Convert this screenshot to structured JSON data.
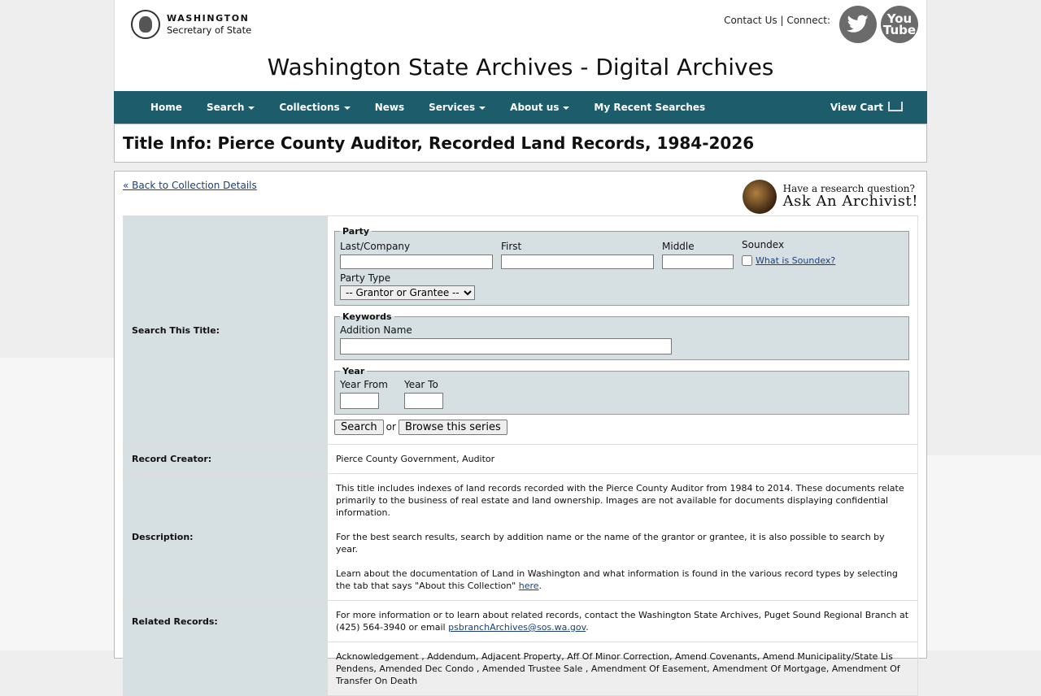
{
  "header": {
    "logo_line1": "WASHINGTON",
    "logo_line2": "Secretary of State",
    "contact": "Contact Us",
    "separator": "|",
    "connect": "Connect:",
    "youtube_line1": "You",
    "youtube_line2": "Tube",
    "site_title": "Washington State Archives - Digital Archives"
  },
  "nav": {
    "items": [
      {
        "label": "Home"
      },
      {
        "label": "Search"
      },
      {
        "label": "Collections"
      },
      {
        "label": "News"
      },
      {
        "label": "Services"
      },
      {
        "label": "About us"
      },
      {
        "label": "My Recent Searches"
      }
    ],
    "cart": "View Cart"
  },
  "page_title": "Title Info: Pierce County Auditor, Recorded Land Records, 1984-2026",
  "back_link": "« Back to Collection Details",
  "ask": {
    "line1": "Have a research question?",
    "line2": "Ask An Archivist!"
  },
  "search": {
    "label": "Search This Title:",
    "party_legend": "Party",
    "last_label": "Last/Company",
    "first_label": "First",
    "middle_label": "Middle",
    "soundex_label": "Soundex",
    "soundex_link": "What is Soundex?",
    "party_type_label": "Party Type",
    "party_type_selected": "-- Grantor or Grantee --",
    "keywords_legend": "Keywords",
    "addition_label": "Addition Name",
    "year_legend": "Year",
    "year_from_label": "Year From",
    "year_to_label": "Year To",
    "search_button": "Search",
    "or_text": "or",
    "browse_button": "Browse this series"
  },
  "record_creator": {
    "label": "Record Creator:",
    "value": "Pierce County Government, Auditor"
  },
  "description": {
    "label": "Description:",
    "p1": "This title includes indexes of land records recorded with the Pierce County Auditor from 1984 to 2014. These documents relate primarily to the business of real estate and land ownership. Images are not available for documents displaying confidential information.",
    "p2": "For the best search results, search by addition name or the name of the grantor or grantee, it is also possible to search by year.",
    "p3_pre": "Learn about the documentation of Land in Washington and what information is found in the various record types by selecting the tab that says \"About this Collection\" ",
    "p3_link": "here",
    "p3_post": "."
  },
  "related": {
    "label": "Related Records:",
    "text_pre": "For more information or to learn about related records, contact the Washington State Archives, Puget Sound Regional Branch at (425) 564-3940 or email ",
    "email": "psbranchArchives@sos.wa.gov",
    "text_post": "."
  },
  "record_types": {
    "text": "Acknowledgement , Addendum, Adjacent Property, Aff Of Minor Correction, Amend Covenants, Amend Municipality/State Lis Pendens, Amended Dec Condo , Amended Trustee Sale , Amendment Of Easement, Amendment Of Mortgage, Amendment Of Transfer On Death"
  }
}
